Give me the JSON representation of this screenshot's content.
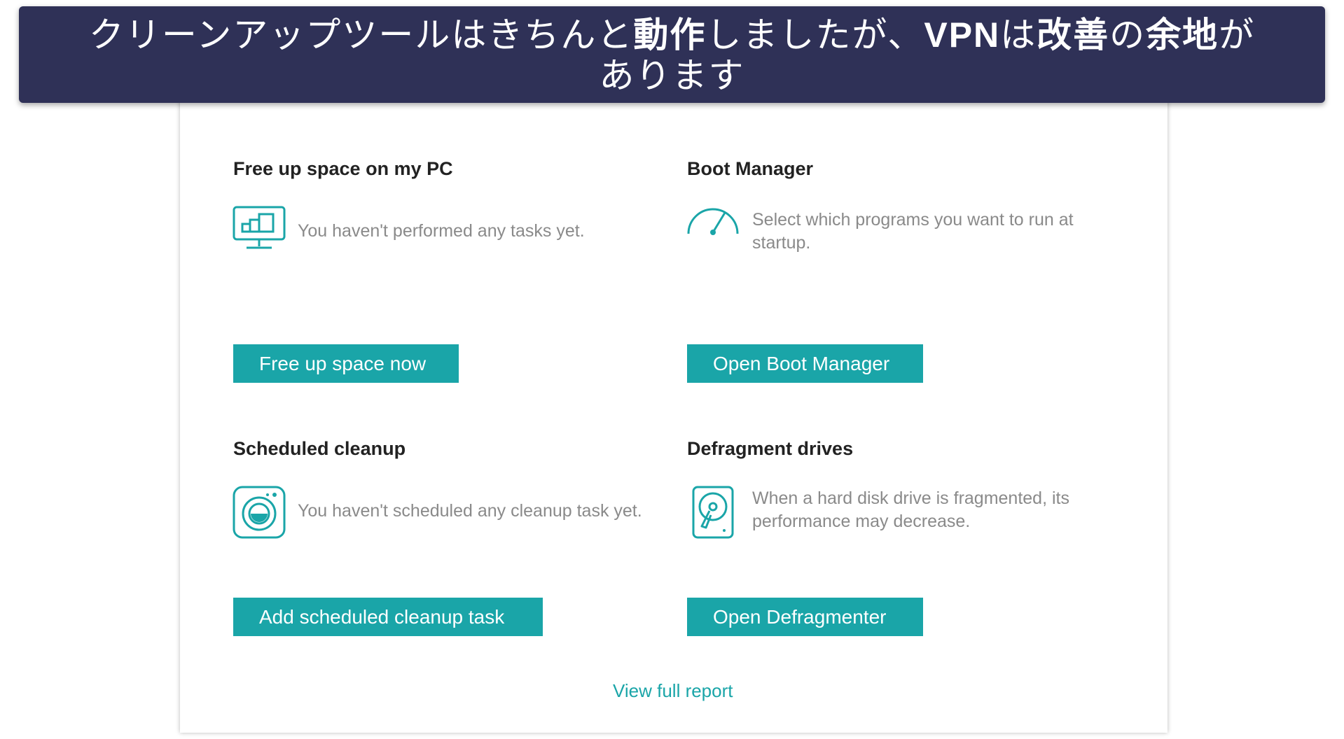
{
  "caption": {
    "part1": "クリーンアップツールはきちんと",
    "part2": "動作",
    "part3": "しましたが、",
    "part4": "VPN",
    "part5": "は",
    "part6": "改善",
    "part7": "の",
    "part8": "余地",
    "part9": "が",
    "line2": "あります"
  },
  "colors": {
    "accent": "#1aa5a8",
    "banner": "#2f3157"
  },
  "sections": {
    "free_space": {
      "title": "Free up space on my PC",
      "description": "You haven't performed any tasks yet.",
      "button": "Free up space now",
      "icon": "monitor-icon"
    },
    "boot_manager": {
      "title": "Boot Manager",
      "description": "Select which programs you want to run at startup.",
      "button": "Open Boot Manager",
      "icon": "speedometer-icon"
    },
    "scheduled_cleanup": {
      "title": "Scheduled cleanup",
      "description": "You haven't scheduled any cleanup task yet.",
      "button": "Add scheduled cleanup task",
      "icon": "washing-machine-icon"
    },
    "defragment": {
      "title": "Defragment drives",
      "description": "When a hard disk drive is fragmented, its performance may decrease.",
      "button": "Open Defragmenter",
      "icon": "hard-disk-icon"
    }
  },
  "footer": {
    "report_link": "View full report"
  }
}
